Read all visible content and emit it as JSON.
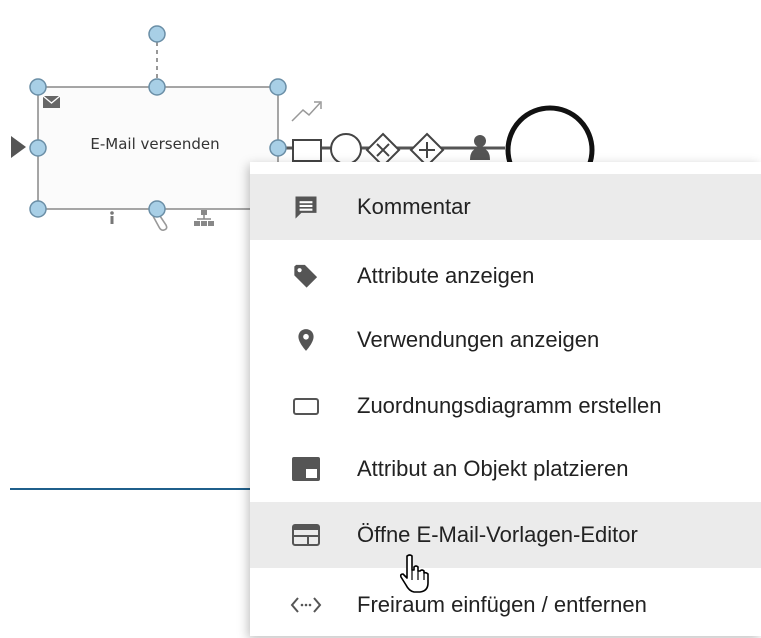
{
  "diagram": {
    "task_label": "E-Mail versenden"
  },
  "context_menu": {
    "items": [
      {
        "label": "Kommentar",
        "icon": "comment-icon",
        "highlighted": true
      },
      {
        "label": "Attribute anzeigen",
        "icon": "tag-icon",
        "highlighted": false
      },
      {
        "label": "Verwendungen anzeigen",
        "icon": "location-pin-icon",
        "highlighted": false
      },
      {
        "label": "Zuordnungsdiagramm erstellen",
        "icon": "rectangle-icon",
        "highlighted": false
      },
      {
        "label": "Attribut an Objekt platzieren",
        "icon": "placement-icon",
        "highlighted": false
      },
      {
        "label": "Öffne E-Mail-Vorlagen-Editor",
        "icon": "template-editor-icon",
        "highlighted": true
      },
      {
        "label": "Freiraum einfügen / entfernen",
        "icon": "code-brackets-icon",
        "highlighted": false
      }
    ]
  },
  "colors": {
    "handle_fill": "#a8cfe6",
    "handle_stroke": "#6a8ea6",
    "icon_gray": "#555555",
    "highlight_bg": "#ebebeb",
    "line_blue": "#1f5f8b"
  }
}
